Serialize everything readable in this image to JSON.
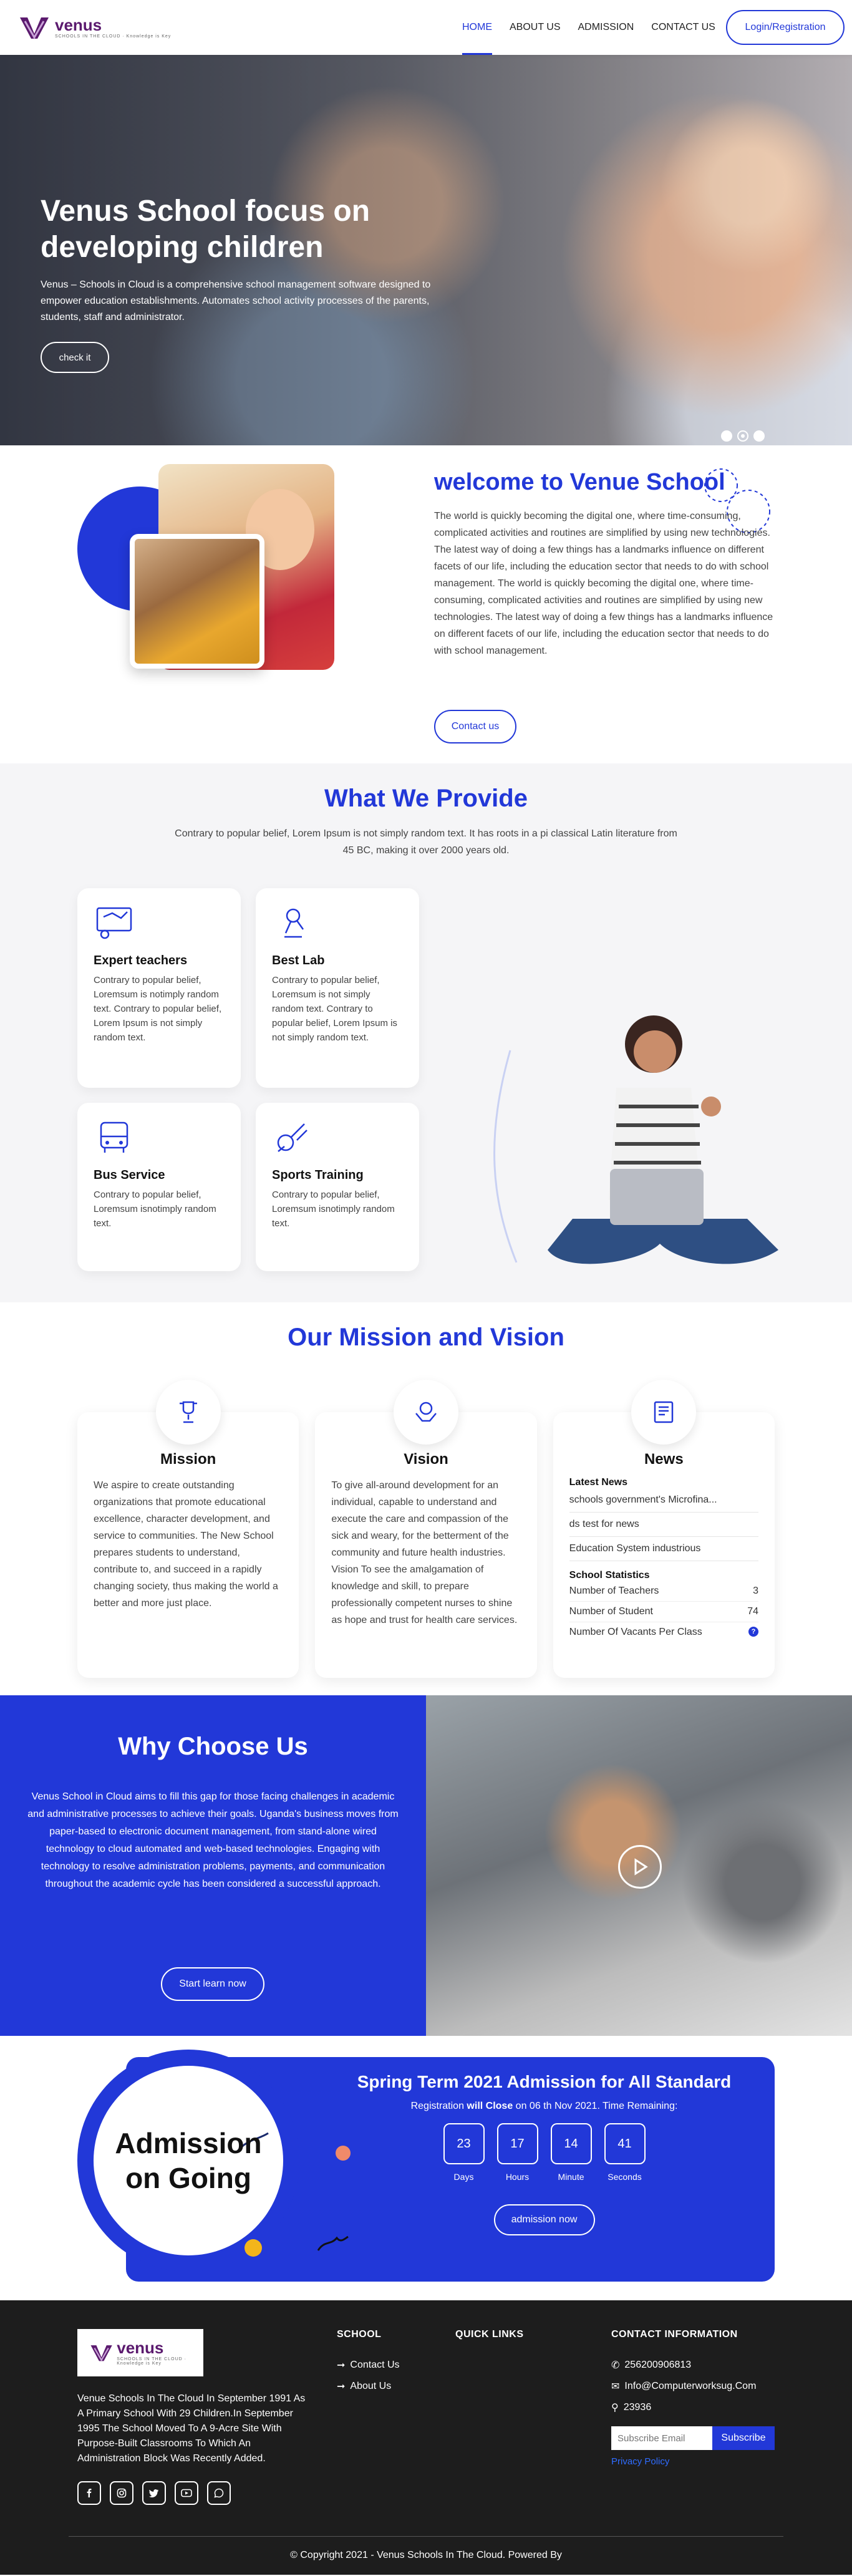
{
  "brand": {
    "name": "venus",
    "tagline": "SCHOOLS IN THE CLOUD · Knowledge is Key"
  },
  "nav": {
    "items": [
      "HOME",
      "ABOUT US",
      "ADMISSION",
      "CONTACT US"
    ],
    "login": "Login/Registration"
  },
  "hero": {
    "title_line1": "Venus School focus on",
    "title_line2": "developing children",
    "text": "Venus – Schools in Cloud is a comprehensive school management software designed to empower education establishments. Automates school activity processes of the parents, students, staff and administrator.",
    "button": "check it"
  },
  "welcome": {
    "title": "welcome to Venue School",
    "text": "The world is quickly becoming the digital one, where time-consuming, complicated activities and routines are simplified by using new technologies. The latest way of doing a few things has a landmarks influence on different facets of our life, including the education sector that needs to do with school management. The world is quickly becoming the digital one, where time-consuming, complicated activities and routines are simplified by using new technologies. The latest way of doing a few things has a landmarks influence on different facets of our life, including the education sector that needs to do with school management.",
    "button": "Contact us"
  },
  "provide": {
    "title": "What We Provide",
    "lead": "Contrary to popular belief, Lorem Ipsum is not simply random text. It has roots in a pi classical Latin literature from 45 BC, making it over 2000 years old.",
    "cards": [
      {
        "title": "Expert teachers",
        "text": "Contrary to popular belief, Loremsum is notimply random text. Contrary to popular belief, Lorem Ipsum is not simply random text."
      },
      {
        "title": "Best Lab",
        "text": "Contrary to popular belief, Loremsum is not simply random text. Contrary to popular belief, Lorem Ipsum is not simply random text."
      },
      {
        "title": "Bus Service",
        "text": "Contrary to popular belief, Loremsum isnotimply random text."
      },
      {
        "title": "Sports Training",
        "text": "Contrary to popular belief, Loremsum isnotimply random text."
      }
    ]
  },
  "mission": {
    "title": "Our Mission and Vision",
    "mission_title": "Mission",
    "mission_text": "We aspire to create outstanding organizations that promote educational excellence, character development, and service to communities. The New School prepares students to understand, contribute to, and succeed in a rapidly changing society, thus making the world a better and more just place.",
    "vision_title": "Vision",
    "vision_text": "To give all-around development for an individual, capable to understand and execute the care and compassion of the sick and weary, for the betterment of the community and future health industries. Vision To see the amalgamation of knowledge and skill, to prepare professionally competent nurses to shine as hope and trust for health care services.",
    "news_title": "News",
    "latest_news_label": "Latest News",
    "news_items": [
      "schools government's Microfina...",
      "ds test for news",
      "Education System industrious"
    ],
    "stats_label": "School Statistics",
    "stats": [
      {
        "label": "Number of Teachers",
        "value": "3"
      },
      {
        "label": "Number of Student",
        "value": "74"
      },
      {
        "label": "Number Of Vacants Per Class",
        "value": "?"
      }
    ]
  },
  "why": {
    "title": "Why Choose Us",
    "text": "Venus School in Cloud aims to fill this gap for those facing challenges in academic and administrative processes to achieve their goals. Uganda's business moves from paper-based to electronic document management, from stand-alone wired technology to cloud automated and web-based technologies. Engaging with technology to resolve administration problems, payments, and communication throughout the academic cycle has been considered a successful approach.",
    "button": "Start learn now"
  },
  "admission": {
    "circle_line1": "Admission",
    "circle_line2": "on Going",
    "title": "Spring Term 2021 Admission for All Standard",
    "sub_pre": "Registration ",
    "sub_bold1": "will",
    "sub_bold2": "Close",
    "sub_post": " on 06 th Nov 2021. Time Remaining:",
    "countdown": [
      {
        "value": "23",
        "label": "Days"
      },
      {
        "value": "17",
        "label": "Hours"
      },
      {
        "value": "14",
        "label": "Minute"
      },
      {
        "value": "41",
        "label": "Seconds"
      }
    ],
    "button": "admission now"
  },
  "footer": {
    "about": "Venue Schools In The Cloud In September 1991 As A Primary School With 29 Children.In September 1995 The School Moved To A 9-Acre Site With Purpose-Built Classrooms To Which An Administration Block Was Recently Added.",
    "school_title": "SCHOOL",
    "school_links": [
      "Contact Us",
      "About Us"
    ],
    "quick_title": "QUICK LINKS",
    "contact_title": "CONTACT INFORMATION",
    "phone": "256200906813",
    "email": "Info@Computerworksug.Com",
    "pobox": "23936",
    "subscribe_placeholder": "Subscribe Email",
    "subscribe_button": "Subscribe",
    "privacy": "Privacy Policy",
    "copyright": "© Copyright 2021 - Venus Schools In The Cloud. Powered By"
  },
  "colors": {
    "primary": "#2238d8",
    "footer": "#1d1d1d",
    "brand": "#5b1a6e"
  }
}
